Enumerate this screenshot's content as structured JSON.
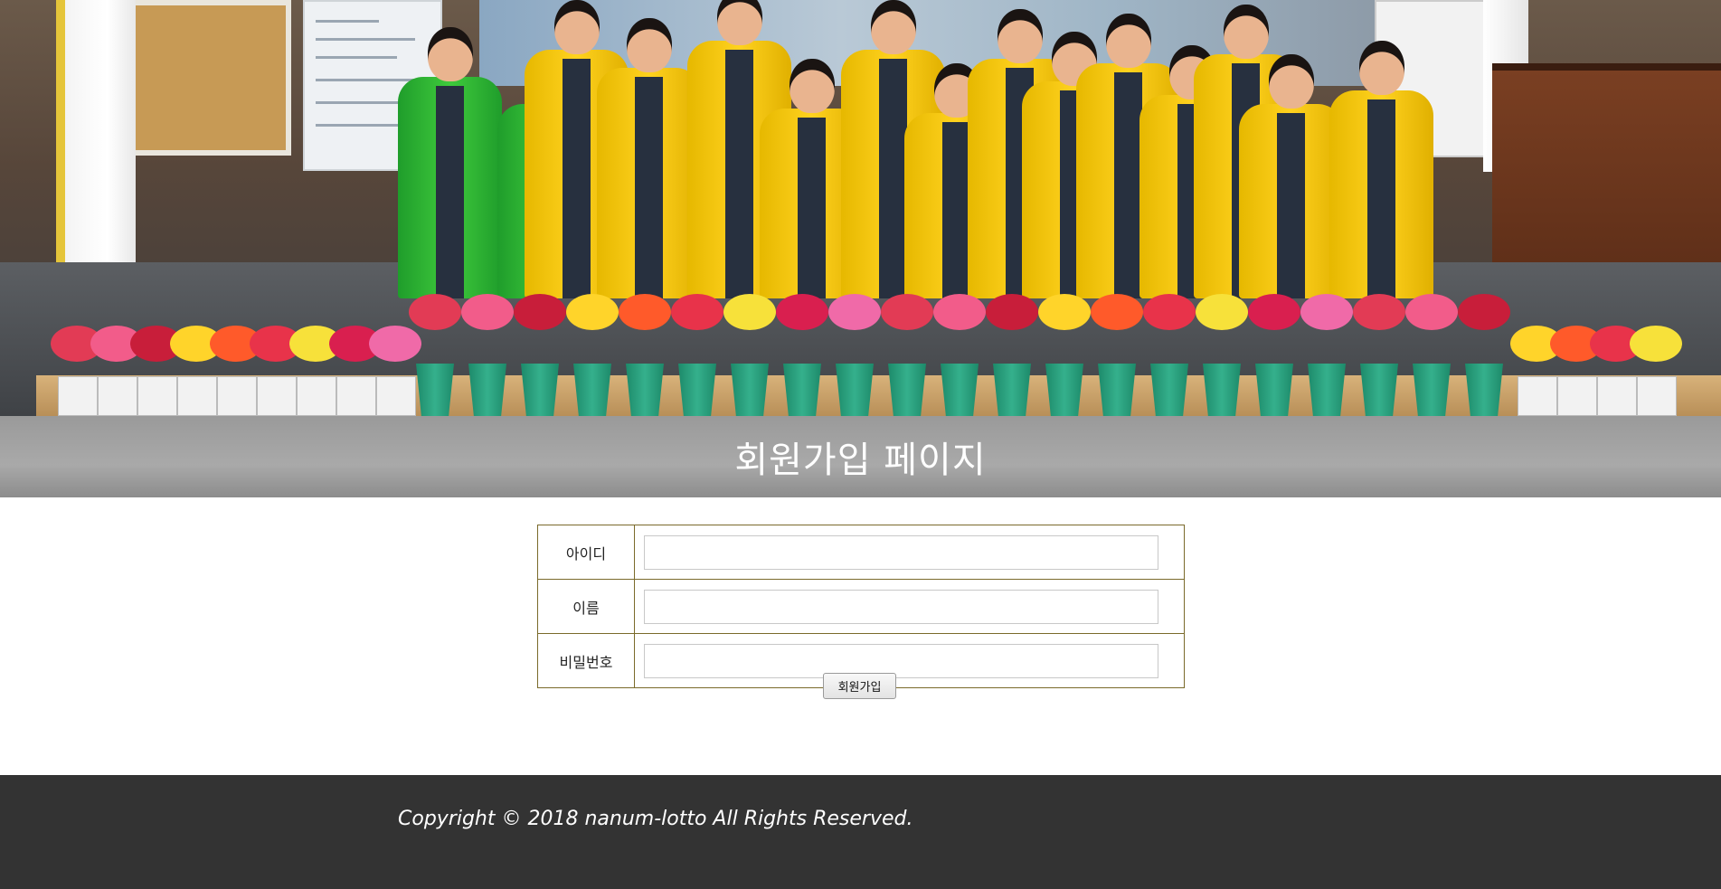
{
  "hero": {
    "image_icon": "group-photo-flowers-image"
  },
  "title": {
    "text": "회원가입 페이지"
  },
  "form": {
    "fields": [
      {
        "label": "아이디",
        "value": "",
        "placeholder": ""
      },
      {
        "label": "이름",
        "value": "",
        "placeholder": ""
      },
      {
        "label": "비밀번호",
        "value": "",
        "placeholder": ""
      }
    ],
    "submit_label": "회원가입"
  },
  "footer": {
    "copyright": "Copyright © 2018 nanum-lotto All Rights Reserved."
  },
  "colors": {
    "title_bar": "#9e9e9e",
    "form_border": "#7a6a2b",
    "footer_bg": "#333333"
  }
}
